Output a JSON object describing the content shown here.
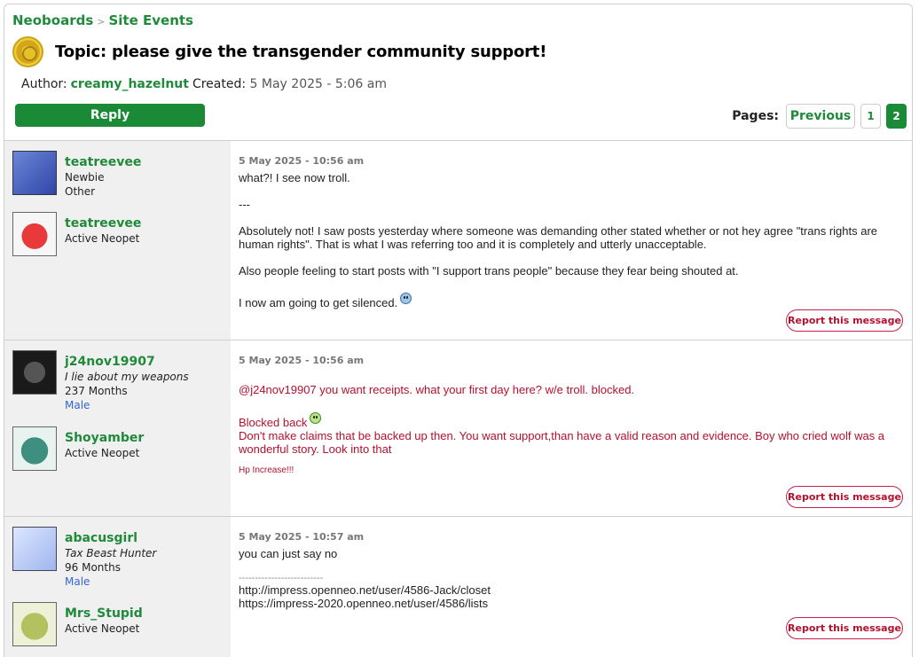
{
  "breadcrumb": {
    "root": "Neoboards",
    "sep": ">",
    "section": "Site Events"
  },
  "topic": {
    "title": "Topic: please give the transgender community support!"
  },
  "meta": {
    "author_label": "Author:",
    "author": "creamy_hazelnut",
    "created_label": "Created:",
    "created": "5 May 2025 - 5:06 am"
  },
  "reply_label": "Reply",
  "pages": {
    "label": "Pages:",
    "previous": "Previous",
    "p1": "1",
    "p2": "2"
  },
  "posts": [
    {
      "users": [
        {
          "name": "teatreevee",
          "lines": [
            "Newbie",
            "Other"
          ]
        },
        {
          "name": "teatreevee",
          "lines": [
            "Active Neopet"
          ]
        }
      ],
      "date": "5 May 2025 - 10:56 am",
      "lines": [
        "what?! I see now troll.",
        "---",
        "Absolutely not! I saw posts yesterday where someone was demanding other stated whether or not hey agree \"trans rights are human rights\". That is what I was referring too and it is completely and utterly unacceptable.",
        "Also people feeling to start posts with \"I support trans people\" because they fear being shouted at.",
        "I now am going to get silenced."
      ],
      "report": "Report this message"
    },
    {
      "users": [
        {
          "name": "j24nov19907",
          "title": "I lie about my weapons",
          "months": "237 Months",
          "gender": "Male"
        },
        {
          "name": "Shoyamber",
          "lines": [
            "Active Neopet"
          ]
        }
      ],
      "date": "5 May 2025 - 10:56 am",
      "lines": [
        "@j24nov19907 you want receipts. what your first day here? w/e troll. blocked.",
        "Blocked back",
        "Don't make claims that be backed up then. You want support,than have a valid reason and evidence. Boy who cried wolf was a wonderful story. Look into that",
        "Hp Increase!!!"
      ],
      "report": "Report this message"
    },
    {
      "users": [
        {
          "name": "abacusgirl",
          "title": "Tax Beast Hunter",
          "months": "96 Months",
          "gender": "Male"
        },
        {
          "name": "Mrs_Stupid",
          "lines": [
            "Active Neopet"
          ]
        }
      ],
      "date": "5 May 2025 - 10:57 am",
      "lines": [
        "you can just say no",
        "--------------------------",
        "http://impress.openneo.net/user/4586-Jack/closet",
        "https://impress-2020.openneo.net/user/4586/lists"
      ],
      "report": "Report this message"
    }
  ]
}
